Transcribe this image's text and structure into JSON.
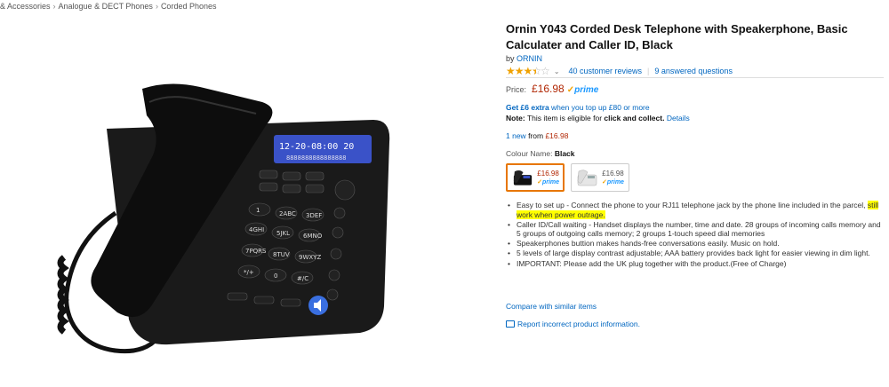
{
  "breadcrumb": [
    "& Accessories",
    "Analogue & DECT Phones",
    "Corded Phones"
  ],
  "breadcrumb_sep": "›",
  "product": {
    "title": "Ornin Y043 Corded Desk Telephone with Speakerphone, Basic Calculater and Caller ID, Black",
    "by_label": "by",
    "brand": "ORNIN",
    "rating": 3.5,
    "reviews_link": "40 customer reviews",
    "questions_link": "9 answered questions",
    "price_label": "Price:",
    "price": "£16.98",
    "prime_label": "prime",
    "promo_bold": "Get £6 extra",
    "promo_rest": "when you top up £80 or more",
    "note_label": "Note:",
    "note_text": "This item is eligible for",
    "note_bold": "click and collect.",
    "note_link": "Details",
    "new_count": "1 new",
    "new_from_label": "from",
    "new_from_price": "£16.98",
    "colour_label": "Colour Name:",
    "colour_value": "Black",
    "swatches": [
      {
        "price": "£16.98",
        "prime": "prime",
        "colour": "black"
      },
      {
        "price": "£16.98",
        "prime": "prime",
        "colour": "white"
      }
    ],
    "bullets": {
      "b1_pre": "Easy to set up - Connect the phone to your RJ11 telephone jack by the phone line included in the parcel,",
      "b1_hl": "still work when power outrage.",
      "b2": "Caller ID/Call waiting - Handset displays the number, time and date. 28 groups of incoming calls memory and 5 groups of outgoing calls memory; 2 groups 1-touch speed dial memories",
      "b3": "Speakerphones buttion makes hands-free conversations easily. Music on hold.",
      "b4": "5 levels of large display contrast adjustable; AAA battery provides back light for easier viewing in dim light.",
      "b5": "IMPORTANT: Please add the UK plug together with the product.(Free of Charge)"
    },
    "compare_link": "Compare with similar items",
    "report_link": "Report incorrect product information."
  },
  "phone": {
    "lcd_line1": "12-20-08:00 20",
    "lcd_line2": "8888888888888888",
    "keys": [
      "1",
      "2ABC",
      "3DEF",
      "4GHI",
      "5JKL",
      "6MNO",
      "7PQRS",
      "8TUV",
      "9WXYZ",
      "*/+",
      "0",
      "#/C"
    ],
    "top_buttons": [
      "UP",
      "DOWN/C",
      "CONTRAST",
      "SET",
      "NO",
      "DEL"
    ],
    "side_labels": [
      "IN USE",
      "OUT/+",
      "R/P MUSIC",
      "SET/STORE",
      "VOL"
    ],
    "bottom_labels": [
      "HOLD/RING/Y",
      "FLASH",
      "RD/BACK"
    ]
  },
  "colors": {
    "link": "#0066c0",
    "price": "#b12704",
    "prime": "#1a98ff",
    "highlight": "#ffff00",
    "star": "#f0a100",
    "selected_border": "#e77600"
  }
}
